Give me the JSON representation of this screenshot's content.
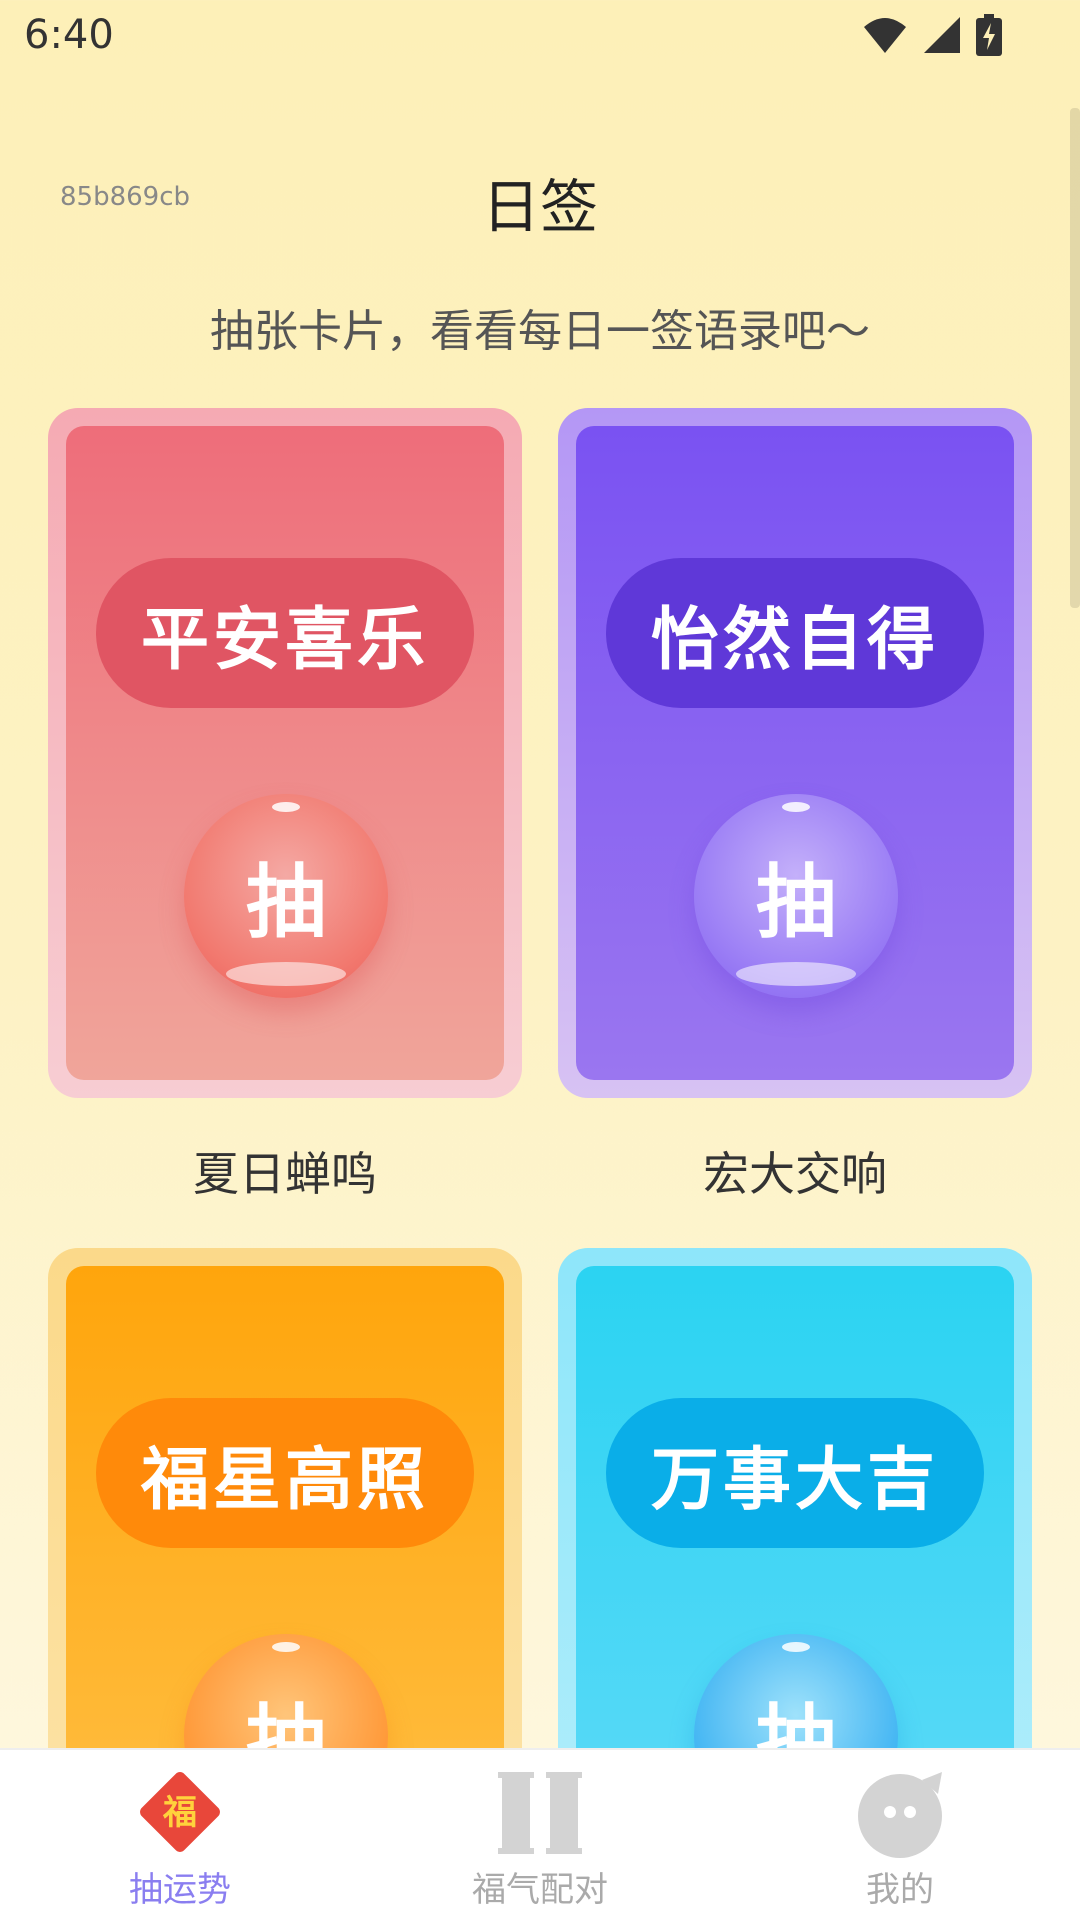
{
  "status_bar": {
    "time": "6:40"
  },
  "header": {
    "device_id": "85b869cb",
    "title": "日签",
    "subtitle": "抽张卡片，看看每日一签语录吧～"
  },
  "cards": [
    {
      "theme": "red",
      "pill_text": "平安喜乐",
      "button_label": "抽",
      "caption": "夏日蝉鸣",
      "accent": "#e05563"
    },
    {
      "theme": "purple",
      "pill_text": "怡然自得",
      "button_label": "抽",
      "caption": "宏大交响",
      "accent": "#5f38d8"
    },
    {
      "theme": "orange",
      "pill_text": "福星高照",
      "button_label": "抽",
      "caption": "",
      "accent": "#ff8a0a"
    },
    {
      "theme": "cyan",
      "pill_text": "万事大吉",
      "button_label": "抽",
      "caption": "",
      "accent": "#0aaee8"
    }
  ],
  "tabbar": {
    "items": [
      {
        "label": "抽运势",
        "icon": "fu-diamond-icon",
        "glyph": "福",
        "active": true,
        "active_color": "#8a7ef0"
      },
      {
        "label": "福气配对",
        "icon": "pillars-icon",
        "active": false
      },
      {
        "label": "我的",
        "icon": "cat-face-icon",
        "active": false
      }
    ]
  }
}
